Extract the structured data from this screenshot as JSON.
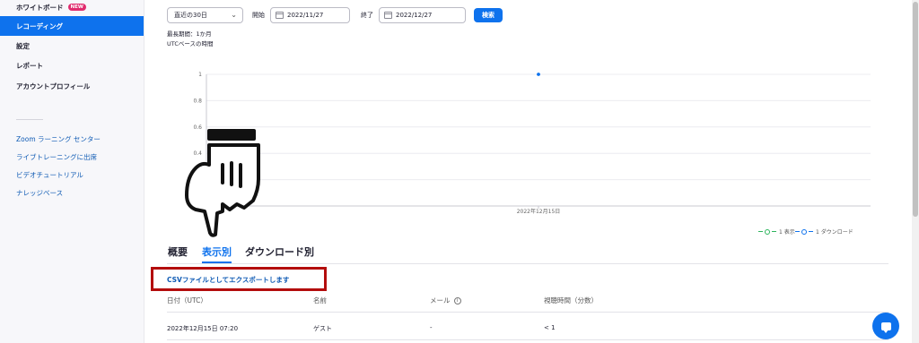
{
  "sidebar": {
    "items": [
      {
        "label": "ホワイトボード",
        "badge": "NEW"
      },
      {
        "label": "レコーディング"
      },
      {
        "label": "設定"
      },
      {
        "label": "レポート"
      },
      {
        "label": "アカウントプロフィール"
      }
    ],
    "links": [
      {
        "label": "Zoom ラーニング センター"
      },
      {
        "label": "ライブトレーニングに出席"
      },
      {
        "label": "ビデオチュートリアル"
      },
      {
        "label": "ナレッジベース"
      }
    ]
  },
  "filters": {
    "range_select": "直近の30日",
    "start_label": "開始",
    "start_date": "2022/11/27",
    "end_label": "終了",
    "end_date": "2022/12/27",
    "search_label": "検索",
    "note_max": "最長期間：1か月",
    "note_utc": "UTCベースの時間"
  },
  "chart_data": {
    "type": "line",
    "x": [
      "2022年12月15日"
    ],
    "series": [
      {
        "name": "1 表示",
        "values": [
          1
        ],
        "color": "#2db55d"
      },
      {
        "name": "1 ダウンロード",
        "values": [
          1
        ],
        "color": "#0e72ed"
      }
    ],
    "yticks": [
      "1",
      "0.8",
      "0.6",
      "0.4"
    ],
    "ylim": [
      0,
      1
    ],
    "grid": true,
    "legend_position": "bottom-right"
  },
  "tabs": [
    {
      "label": "概要"
    },
    {
      "label": "表示別"
    },
    {
      "label": "ダウンロード別"
    }
  ],
  "export_label": "CSVファイルとしてエクスポートします",
  "table": {
    "headers": [
      "日付（UTC）",
      "名前",
      "メール",
      "視聴時間（分数）"
    ],
    "info_icon": "i",
    "rows": [
      [
        "2022年12月15日 07:20",
        "ゲスト",
        "-",
        "< 1"
      ]
    ]
  },
  "icons": {
    "chevron": "chevron-down-icon",
    "calendar": "calendar-icon",
    "chat": "chat-icon",
    "pointer": "pointing-hand-icon"
  }
}
